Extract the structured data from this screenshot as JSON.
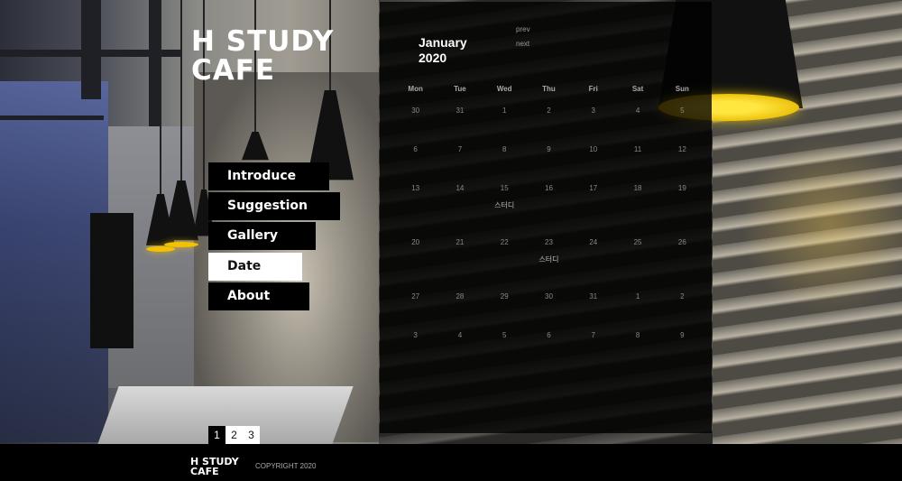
{
  "logo": {
    "line1": "H STUDY",
    "line2": "CAFE"
  },
  "nav": {
    "items": [
      {
        "label": "Introduce",
        "active": false
      },
      {
        "label": "Suggestion",
        "active": false
      },
      {
        "label": "Gallery",
        "active": false
      },
      {
        "label": "Date",
        "active": true
      },
      {
        "label": "About",
        "active": false
      }
    ]
  },
  "pager": {
    "pages": [
      "1",
      "2",
      "3"
    ],
    "active": "1"
  },
  "calendar": {
    "month": "January",
    "year": "2020",
    "prev_label": "prev",
    "next_label": "next",
    "weekdays": [
      "Mon",
      "Tue",
      "Wed",
      "Thu",
      "Fri",
      "Sat",
      "Sun"
    ],
    "weeks": [
      [
        {
          "d": "30"
        },
        {
          "d": "31"
        },
        {
          "d": "1"
        },
        {
          "d": "2"
        },
        {
          "d": "3"
        },
        {
          "d": "4"
        },
        {
          "d": "5"
        }
      ],
      [
        {
          "d": "6"
        },
        {
          "d": "7"
        },
        {
          "d": "8"
        },
        {
          "d": "9"
        },
        {
          "d": "10"
        },
        {
          "d": "11"
        },
        {
          "d": "12"
        }
      ],
      [
        {
          "d": "13"
        },
        {
          "d": "14"
        },
        {
          "d": "15",
          "e": "스터디"
        },
        {
          "d": "16"
        },
        {
          "d": "17"
        },
        {
          "d": "18"
        },
        {
          "d": "19"
        }
      ],
      [
        {
          "d": "20"
        },
        {
          "d": "21"
        },
        {
          "d": "22"
        },
        {
          "d": "23",
          "e": "스터디"
        },
        {
          "d": "24"
        },
        {
          "d": "25"
        },
        {
          "d": "26"
        }
      ],
      [
        {
          "d": "27"
        },
        {
          "d": "28"
        },
        {
          "d": "29"
        },
        {
          "d": "30"
        },
        {
          "d": "31"
        },
        {
          "d": "1"
        },
        {
          "d": "2"
        }
      ],
      [
        {
          "d": "3"
        },
        {
          "d": "4"
        },
        {
          "d": "5"
        },
        {
          "d": "6"
        },
        {
          "d": "7"
        },
        {
          "d": "8"
        },
        {
          "d": "9"
        }
      ]
    ]
  },
  "footer": {
    "logo_line1": "H STUDY",
    "logo_line2": "CAFE",
    "copyright": "COPYRIGHT 2020"
  },
  "colors": {
    "accent_lamp": "#f2c200",
    "panel": "#000000",
    "active_nav": "#ffffff"
  }
}
